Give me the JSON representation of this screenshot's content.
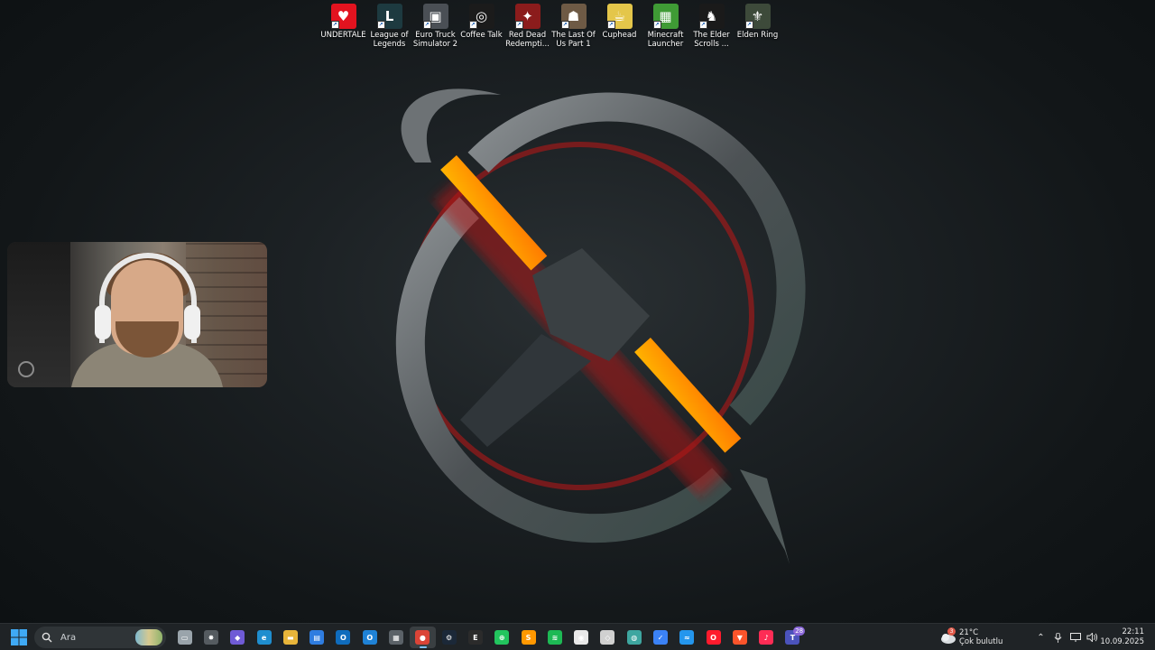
{
  "desktop": {
    "icons": [
      {
        "label": "UNDERTALE",
        "icon": "undertale-heart-icon",
        "color": "#e2131f",
        "glyph": "♥"
      },
      {
        "label": "League of Legends",
        "icon": "league-of-legends-icon",
        "color": "#1d3a40",
        "glyph": "L"
      },
      {
        "label": "Euro Truck Simulator 2",
        "icon": "euro-truck-icon",
        "color": "#4a4f55",
        "glyph": "▣"
      },
      {
        "label": "Coffee Talk",
        "icon": "coffee-talk-icon",
        "color": "#1b1b1b",
        "glyph": "◎"
      },
      {
        "label": "Red Dead Redempti...",
        "icon": "red-dead-icon",
        "color": "#8b1c1c",
        "glyph": "✦"
      },
      {
        "label": "The Last Of Us Part 1",
        "icon": "last-of-us-icon",
        "color": "#6e5a45",
        "glyph": "☗"
      },
      {
        "label": "Cuphead",
        "icon": "cuphead-icon",
        "color": "#e4c64a",
        "glyph": "☕"
      },
      {
        "label": "Minecraft Launcher",
        "icon": "minecraft-icon",
        "color": "#3f9b35",
        "glyph": "▦"
      },
      {
        "label": "The Elder Scrolls ...",
        "icon": "elder-scrolls-icon",
        "color": "#1a1a1a",
        "glyph": "♞"
      },
      {
        "label": "Elden Ring",
        "icon": "elden-ring-icon",
        "color": "#3d4a3a",
        "glyph": "⚜"
      }
    ]
  },
  "taskbar": {
    "search_placeholder": "Ara",
    "apps": [
      {
        "name": "task-view-icon",
        "color": "#9aa4ab",
        "glyph": "▭"
      },
      {
        "name": "copilot-bug-icon",
        "color": "#555b60",
        "glyph": "✸"
      },
      {
        "name": "copilot-icon",
        "color": "#6f5bd6",
        "glyph": "◆"
      },
      {
        "name": "edge-icon",
        "color": "#1f8ecf",
        "glyph": "e"
      },
      {
        "name": "file-explorer-icon",
        "color": "#e7b43a",
        "glyph": "▬"
      },
      {
        "name": "microsoft-store-icon",
        "color": "#2f7de0",
        "glyph": "▤"
      },
      {
        "name": "outlook-icon",
        "color": "#0f6cbd",
        "glyph": "O"
      },
      {
        "name": "outlook-new-icon",
        "color": "#1f82d6",
        "glyph": "O"
      },
      {
        "name": "calculator-icon",
        "color": "#5b6268",
        "glyph": "▦"
      },
      {
        "name": "chrome-icon",
        "color": "#db4437",
        "glyph": "●",
        "active": true
      },
      {
        "name": "steam-icon",
        "color": "#1b2838",
        "glyph": "⚙"
      },
      {
        "name": "epic-games-icon",
        "color": "#2b2b2b",
        "glyph": "E"
      },
      {
        "name": "razer-icon",
        "color": "#22c55e",
        "glyph": "⊕"
      },
      {
        "name": "sublime-icon",
        "color": "#ff9800",
        "glyph": "S"
      },
      {
        "name": "spotify-icon",
        "color": "#1db954",
        "glyph": "≋"
      },
      {
        "name": "obs-icon",
        "color": "#e8e8e8",
        "glyph": "◉"
      },
      {
        "name": "unity-icon",
        "color": "#d0d0d0",
        "glyph": "◇"
      },
      {
        "name": "vpn-globe-icon",
        "color": "#3ea6a0",
        "glyph": "◍"
      },
      {
        "name": "tick-tasks-icon",
        "color": "#3b82f6",
        "glyph": "✓"
      },
      {
        "name": "docker-icon",
        "color": "#2496ed",
        "glyph": "≈"
      },
      {
        "name": "opera-icon",
        "color": "#ff1b2d",
        "glyph": "O"
      },
      {
        "name": "brave-icon",
        "color": "#fb542b",
        "glyph": "▼"
      },
      {
        "name": "tiktok-icon",
        "color": "#fe2c55",
        "glyph": "♪"
      },
      {
        "name": "teams-icon",
        "color": "#4b53bc",
        "glyph": "T",
        "badge": "28"
      }
    ],
    "weather": {
      "temp": "21°C",
      "desc": "Çok bulutlu",
      "badge": "3"
    },
    "clock": {
      "time": "22:11",
      "date": "10.09.2025"
    }
  }
}
